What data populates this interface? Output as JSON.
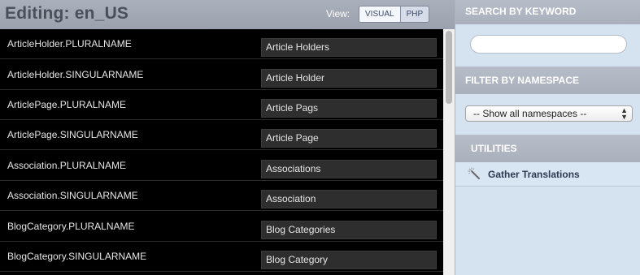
{
  "header": {
    "title": "Editing: en_US",
    "view_label": "View:",
    "view_options": [
      "VISUAL",
      "PHP"
    ],
    "view_selected": "VISUAL"
  },
  "rows": [
    {
      "key": "ArticleHolder.PLURALNAME",
      "value": "Article Holders"
    },
    {
      "key": "ArticleHolder.SINGULARNAME",
      "value": "Article Holder"
    },
    {
      "key": "ArticlePage.PLURALNAME",
      "value": "Article Pags"
    },
    {
      "key": "ArticlePage.SINGULARNAME",
      "value": "Article Page"
    },
    {
      "key": "Association.PLURALNAME",
      "value": "Associations"
    },
    {
      "key": "Association.SINGULARNAME",
      "value": "Association"
    },
    {
      "key": "BlogCategory.PLURALNAME",
      "value": "Blog Categories"
    },
    {
      "key": "BlogCategory.SINGULARNAME",
      "value": "Blog Category"
    }
  ],
  "sidebar": {
    "keyword": {
      "heading": "SEARCH BY KEYWORD",
      "value": ""
    },
    "namespace": {
      "heading": "FILTER BY NAMESPACE",
      "selected": "-- Show all namespaces --"
    },
    "utilities": {
      "heading": "UTILITIES",
      "gather_label": "Gather Translations",
      "gather_icon": "magic-wand-icon"
    }
  },
  "colors": {
    "header_bg": "#9aa1ad",
    "sidebar_bg": "#d5e2ef",
    "row_bg": "#000000",
    "input_bg": "#2e2e2e"
  }
}
